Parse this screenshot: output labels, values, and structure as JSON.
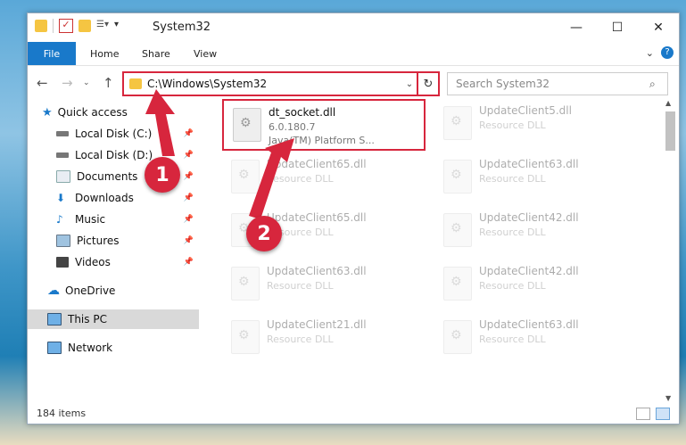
{
  "window": {
    "title": "System32"
  },
  "ribbon": {
    "file": "File",
    "home": "Home",
    "share": "Share",
    "view": "View"
  },
  "address": {
    "path": "C:\\Windows\\System32"
  },
  "search": {
    "placeholder": "Search System32"
  },
  "nav": {
    "quick_access": "Quick access",
    "local_c": "Local Disk (C:)",
    "local_d": "Local Disk (D:)",
    "documents": "Documents",
    "downloads": "Downloads",
    "music": "Music",
    "pictures": "Pictures",
    "videos": "Videos",
    "onedrive": "OneDrive",
    "this_pc": "This PC",
    "network": "Network"
  },
  "files": {
    "main": {
      "name": "dt_socket.dll",
      "version": "6.0.180.7",
      "desc": "Java(TM) Platform S..."
    },
    "r1c2": {
      "name": "UpdateClient5.dll",
      "desc": "Resource DLL"
    },
    "r2c1": {
      "name": "UpdateClient65.dll",
      "desc": "Resource DLL"
    },
    "r2c2": {
      "name": "UpdateClient63.dll",
      "desc": "Resource DLL"
    },
    "r3c1": {
      "name": "UpdateClient65.dll",
      "desc": "Resource DLL"
    },
    "r3c2": {
      "name": "UpdateClient42.dll",
      "desc": "Resource DLL"
    },
    "r4c1": {
      "name": "UpdateClient63.dll",
      "desc": "Resource DLL"
    },
    "r4c2": {
      "name": "UpdateClient42.dll",
      "desc": "Resource DLL"
    },
    "r5c1": {
      "name": "UpdateClient21.dll",
      "desc": "Resource DLL"
    },
    "r5c2": {
      "name": "UpdateClient63.dll",
      "desc": "Resource DLL"
    }
  },
  "status": {
    "count": "184 items"
  },
  "callouts": {
    "one": "1",
    "two": "2"
  },
  "colors": {
    "accent": "#1979ca",
    "highlight": "#d7263d",
    "callout": "#d7263d"
  }
}
